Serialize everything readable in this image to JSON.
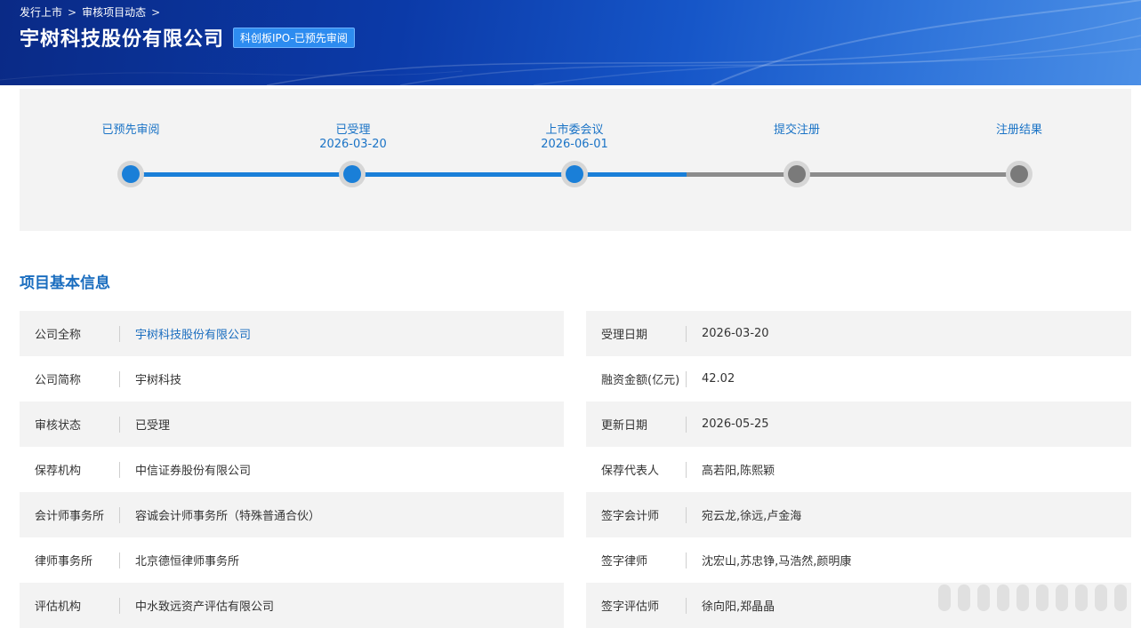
{
  "breadcrumb": {
    "items": [
      "发行上市",
      "审核项目动态"
    ],
    "separator": ">"
  },
  "header": {
    "title": "宇树科技股份有限公司",
    "badge": "科创板IPO-已预先审阅"
  },
  "progress": {
    "current_step": 3,
    "steps": [
      {
        "label": "已预先审阅",
        "date": ""
      },
      {
        "label": "已受理",
        "date": "2026-03-20"
      },
      {
        "label": "上市委会议",
        "date": "2026-06-01"
      },
      {
        "label": "提交注册",
        "date": ""
      },
      {
        "label": "注册结果",
        "date": ""
      }
    ]
  },
  "section": {
    "title": "项目基本信息"
  },
  "info": {
    "left": [
      {
        "label": "公司全称",
        "value": "宇树科技股份有限公司"
      },
      {
        "label": "公司简称",
        "value": "宇树科技"
      },
      {
        "label": "审核状态",
        "value": "已受理"
      },
      {
        "label": "保荐机构",
        "value": "中信证券股份有限公司"
      },
      {
        "label": "会计师事务所",
        "value": "容诚会计师事务所（特殊普通合伙）"
      },
      {
        "label": "律师事务所",
        "value": "北京德恒律师事务所"
      },
      {
        "label": "评估机构",
        "value": "中水致远资产评估有限公司"
      }
    ],
    "right": [
      {
        "label": "受理日期",
        "value": "2026-03-20"
      },
      {
        "label": "融资金额(亿元)",
        "value": "42.02"
      },
      {
        "label": "更新日期",
        "value": "2026-05-25"
      },
      {
        "label": "保荐代表人",
        "value": "高若阳,陈熙颖"
      },
      {
        "label": "签字会计师",
        "value": "宛云龙,徐远,卢金海"
      },
      {
        "label": "签字律师",
        "value": "沈宏山,苏忠铮,马浩然,颜明康"
      },
      {
        "label": "签字评估师",
        "value": "徐向阳,郑晶晶"
      }
    ]
  },
  "colors": {
    "accent": "#1a7fd8",
    "header_dark": "#0a2a86",
    "link": "#1a6dbf",
    "pending": "#7a7a7a"
  }
}
